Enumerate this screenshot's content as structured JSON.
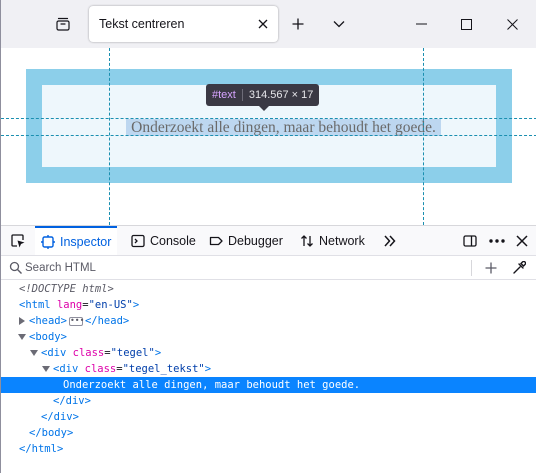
{
  "browser": {
    "tab_title": "Tekst centreren"
  },
  "page": {
    "text": "Onderzoekt alle dingen, maar behoudt het goede."
  },
  "highlighter_tooltip": {
    "tag": "#text",
    "size": "314.567 × 17"
  },
  "devtools": {
    "tabs": [
      {
        "label": "Inspector",
        "icon": "inspector-icon"
      },
      {
        "label": "Console",
        "icon": "console-icon"
      },
      {
        "label": "Debugger",
        "icon": "debugger-icon"
      },
      {
        "label": "Network",
        "icon": "network-icon"
      }
    ],
    "search_placeholder": "Search HTML",
    "markup": {
      "doctype": "<!DOCTYPE html>",
      "html_tag": "html",
      "html_attr_name": "lang",
      "html_attr_value": "\"en-US\"",
      "head_tag": "head",
      "body_tag": "body",
      "div_tag": "div",
      "class_attr": "class",
      "tegel_value": "\"tegel\"",
      "tegel_tekst_value": "\"tegel_tekst\"",
      "text_node": "Onderzoekt alle dingen, maar behoudt het goede."
    }
  },
  "colors": {
    "tegel_border": "#8ccfea",
    "tegel_background": "#eef7fc",
    "selection": "#0a84ff",
    "accent": "#0061e0"
  }
}
